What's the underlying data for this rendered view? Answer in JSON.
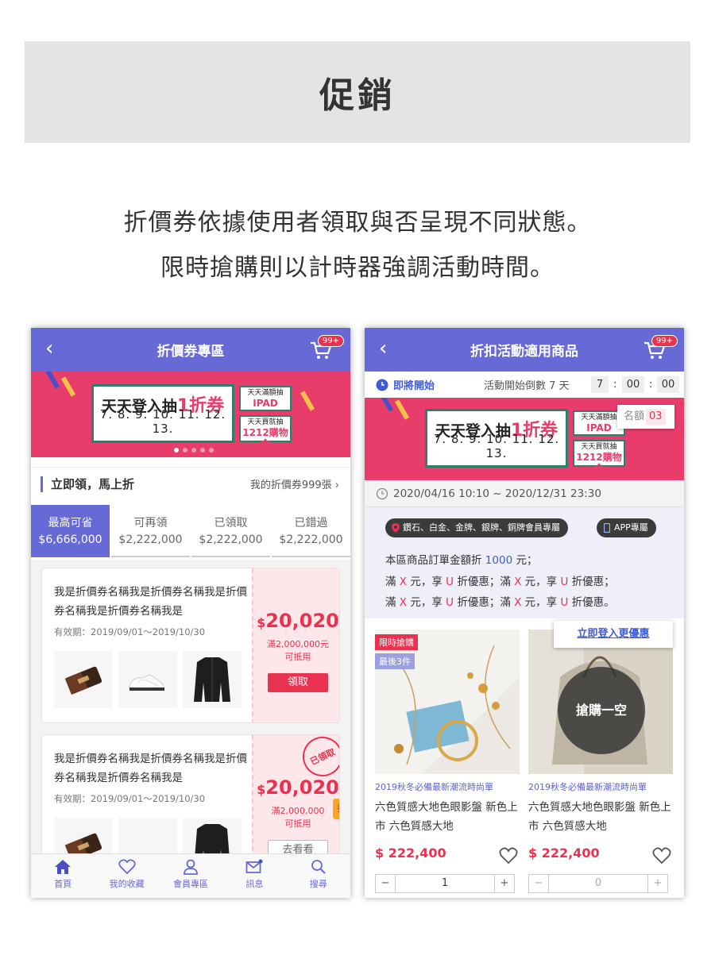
{
  "header": {
    "title": "促銷"
  },
  "description": {
    "line1": "折價券依據使用者領取與否呈現不同狀態。",
    "line2": "限時搶購則以計時器強調活動時間。"
  },
  "cart_badge": "99+",
  "promo_banner": {
    "headline_prefix": "天天登入抽",
    "headline_highlight": "1折券",
    "dates": "7. 8. 9. 10. 11. 12. 13.",
    "mini1_top": "天天滿額抽",
    "mini1_main": "IPAD",
    "mini2_top": "天天買就抽",
    "mini2_main": "1212購物金"
  },
  "left_phone": {
    "title": "折價券專區",
    "section_title": "立即領，馬上折",
    "my_coupons": "我的折價券999張",
    "tabs": [
      {
        "label": "最高可省",
        "value": "$6,666,000"
      },
      {
        "label": "可再領",
        "value": "$2,222,000"
      },
      {
        "label": "已領取",
        "value": "$2,222,000"
      },
      {
        "label": "已錯過",
        "value": "$2,222,000"
      }
    ],
    "coupons": [
      {
        "name": "我是折價券名稱我是折價券名稱我是折價券名稱我是折價券名稱我是",
        "valid": "有效期：2019/09/01～2019/10/30",
        "currency": "$",
        "amount": "20,020",
        "condition1": "滿2,000,000元",
        "condition2": "可抵用",
        "button": "領取"
      },
      {
        "name": "我是折價券名稱我是折價券名稱我是折價券名稱我是折價券名稱我是",
        "valid": "有效期：2019/09/01～2019/10/30",
        "currency": "$",
        "amount": "20,020",
        "condition1": "滿2,000,000",
        "condition2": "可抵用",
        "button": "去看看",
        "stamp": "已領取",
        "badge": "券"
      }
    ],
    "tabbar": [
      {
        "label": "首頁",
        "icon": "home-icon"
      },
      {
        "label": "我的收藏",
        "icon": "heart-icon"
      },
      {
        "label": "會員專區",
        "icon": "user-icon"
      },
      {
        "label": "訊息",
        "icon": "mail-icon"
      },
      {
        "label": "搜尋",
        "icon": "search-icon"
      }
    ]
  },
  "right_phone": {
    "title": "折扣活動適用商品",
    "status": "即將開始",
    "countdown_label": "活動開始倒數 7 天",
    "timer": {
      "hours": "7",
      "minutes": "00",
      "seconds": "00"
    },
    "name_tag": "名額",
    "name_count": "03",
    "date_range": "2020/04/16 10:10 ~ 2020/12/31 23:30",
    "pill1": "鑽石、白金、金牌、銀牌、銅牌會員專屬",
    "pill2": "APP專屬",
    "info_line1_prefix": "本區商品訂單金額折",
    "info_line1_amount": "1000",
    "info_line1_suffix": "元；",
    "info_line2": [
      "滿",
      "X",
      "元，享",
      "U",
      "折優惠；滿",
      "X",
      "元，享",
      "U",
      "折優惠；"
    ],
    "info_line3": [
      "滿",
      "X",
      "元，享",
      "U",
      "折優惠；滿",
      "X",
      "元，享",
      "U",
      "折優惠。"
    ],
    "login_tip": "立即登入更優惠",
    "products": [
      {
        "tag1": "限時搶購",
        "tag2": "最後3件",
        "subtitle": "2019秋冬必備最新潮流時尚單",
        "name": "六色質感大地色眼影盤 新色上市 六色質感大地",
        "price": "$ 222,400",
        "qty": "1"
      },
      {
        "sold_out": "搶購一空",
        "subtitle": "2019秋冬必備最新潮流時尚單",
        "name": "六色質感大地色眼影盤 新色上市 六色質感大地",
        "price": "$ 222,400",
        "qty": "0"
      }
    ],
    "stepper_minus": "−",
    "stepper_plus": "+"
  },
  "colors": {
    "primary": "#6769d6",
    "accent": "#e8324f",
    "banner_pink": "#e83d6b",
    "link_blue": "#3f5bd8"
  }
}
